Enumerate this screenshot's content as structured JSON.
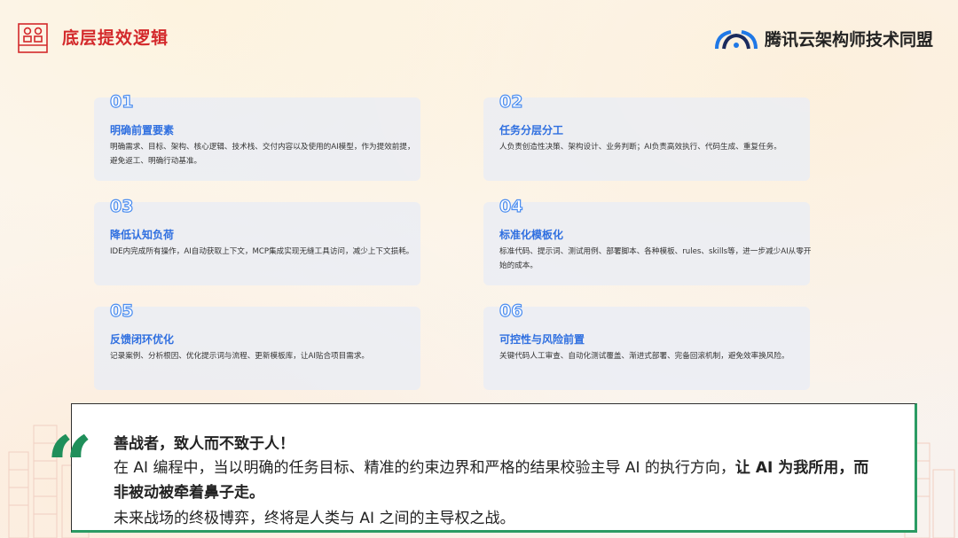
{
  "header": {
    "title": "底层提效逻辑",
    "brand": "腾讯云架构师技术同盟"
  },
  "cards": [
    {
      "num": "01",
      "title": "明确前置要素",
      "desc": "明确需求、目标、架构、核心逻辑、技术栈、交付内容以及使用的AI模型，作为提效前提，避免返工、明确行动基准。"
    },
    {
      "num": "02",
      "title": "任务分层分工",
      "desc": "人负责创造性决策、架构设计、业务判断；AI负责高效执行、代码生成、重复任务。"
    },
    {
      "num": "03",
      "title": "降低认知负荷",
      "desc": "IDE内完成所有操作，AI自动获取上下文，MCP集成实现无缝工具访问，减少上下文损耗。"
    },
    {
      "num": "04",
      "title": "标准化模板化",
      "desc": "标准代码、提示词、测试用例、部署脚本、各种模板、rules、skills等，进一步减少AI从零开始的成本。"
    },
    {
      "num": "05",
      "title": "反馈闭环优化",
      "desc": "记录案例、分析根因、优化提示词与流程、更新模板库，让AI贴合项目需求。"
    },
    {
      "num": "06",
      "title": "可控性与风险前置",
      "desc": "关键代码人工审查、自动化测试覆盖、渐进式部署、完备回滚机制，避免效率换风险。"
    }
  ],
  "quote": {
    "mark": "“",
    "line1": "善战者，致人而不致于人！",
    "line2_pre": "在 AI 编程中，当以明确的任务目标、精准的约束边界和严格的结果校验主导 AI 的执行方向，",
    "line2_bold": "让 AI 为我所用，而非被动被牵着鼻子走。",
    "line3": "未来战场的终极博弈，终将是人类与 AI 之间的主导权之战。"
  },
  "colors": {
    "accent_red": "#d3292b",
    "accent_blue": "#2f6fe0",
    "accent_green": "#1f8f5a"
  },
  "icons": {
    "logo": "grid-logo-icon",
    "brand": "tencent-cloud-logo-icon",
    "quote": "quote-mark-icon"
  }
}
